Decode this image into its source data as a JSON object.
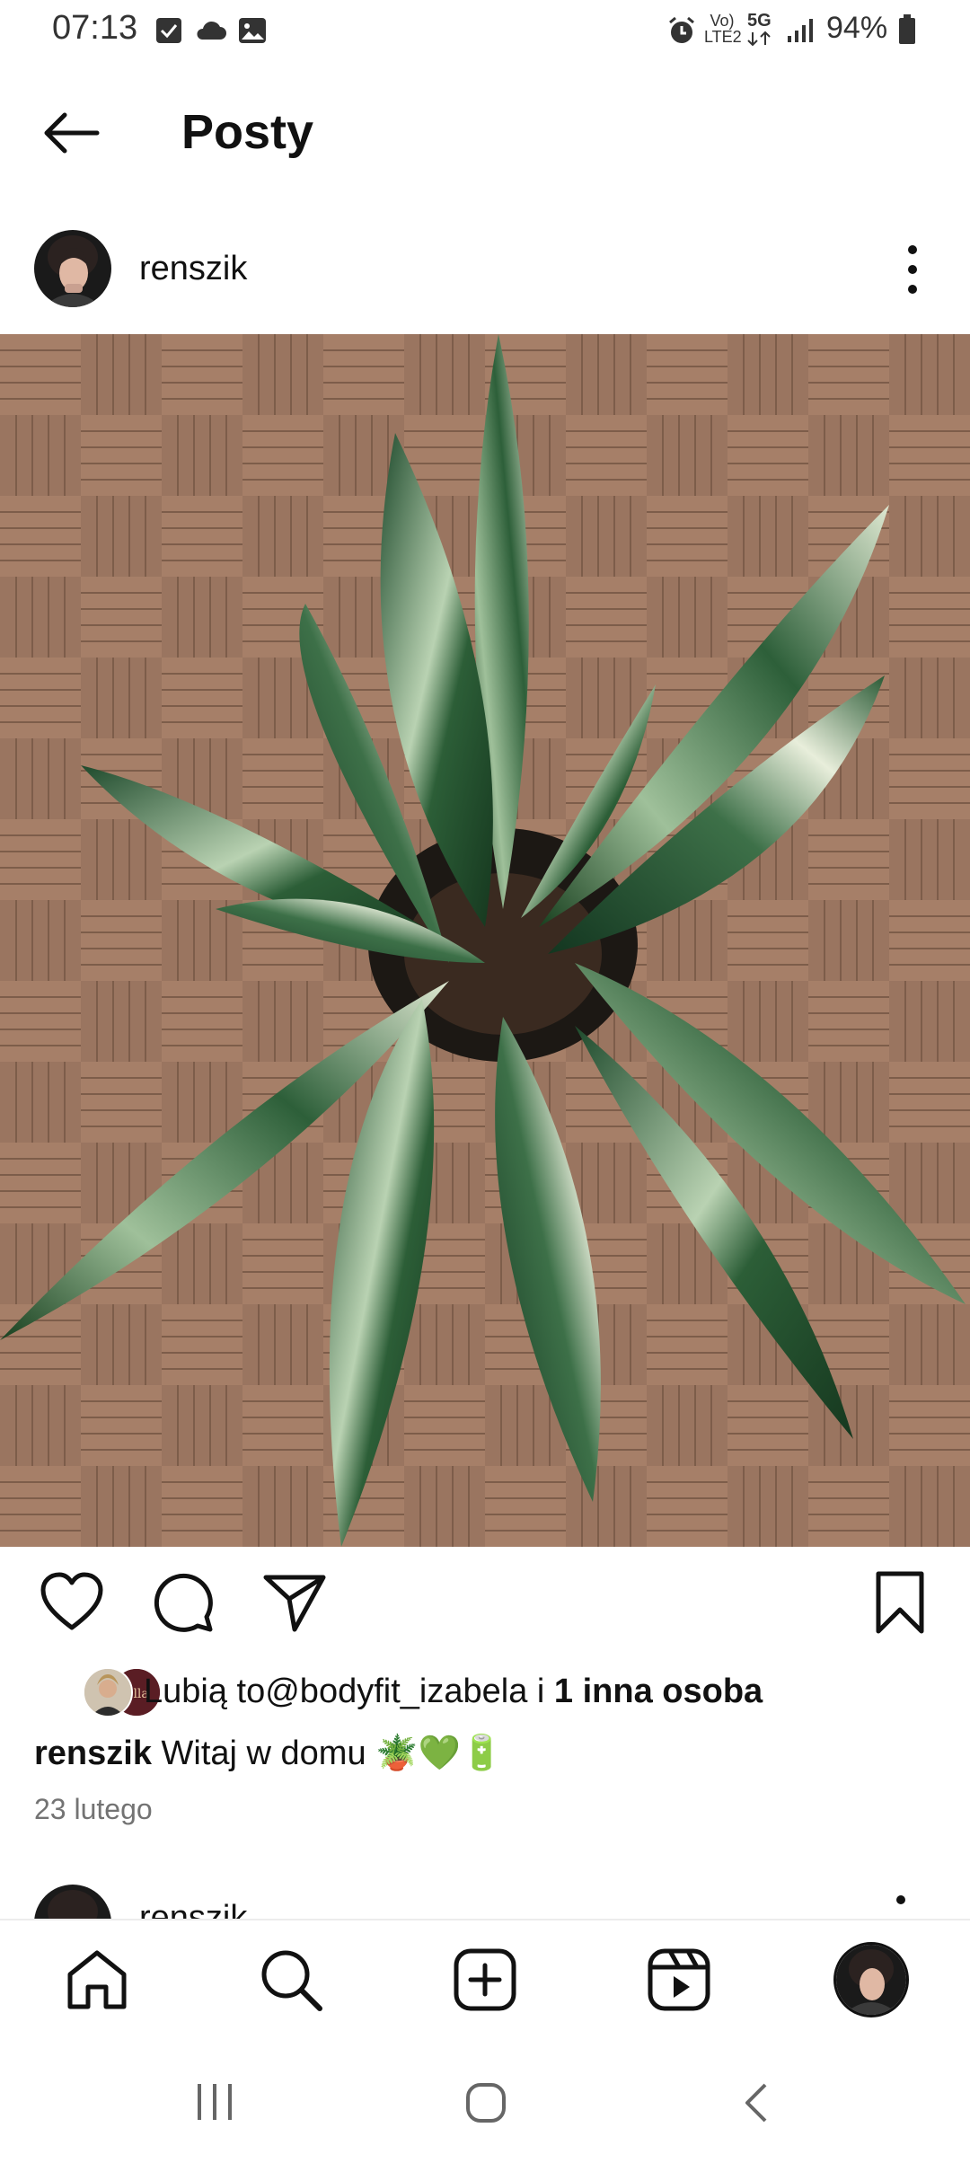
{
  "status_bar": {
    "time": "07:13",
    "network_text": "Vo) LTE2",
    "network_5g": "5G",
    "battery": "94%"
  },
  "header": {
    "title": "Posty",
    "back_icon": "arrow-left-icon"
  },
  "post": {
    "username": "renszik",
    "more_icon": "more-vertical-icon",
    "image_description_icon": "photo",
    "actions": [
      "heart-icon",
      "comment-icon",
      "share-icon",
      "bookmark-icon"
    ],
    "likes": {
      "prefix": "Lubią to",
      "user": "@bodyfit_izabela",
      "middle": " i ",
      "others": "1 inna osoba"
    },
    "caption": {
      "user": "renszik",
      "text": "Witaj w domu 🪴💚🔋"
    },
    "date": "23 lutego"
  },
  "next_post": {
    "username": "renszik"
  },
  "bottom_nav": {
    "items": [
      "home-icon",
      "search-icon",
      "create-icon",
      "reels-icon",
      "profile-avatar"
    ]
  },
  "colors": {
    "text": "#111111",
    "muted": "#737373",
    "background": "#ffffff"
  }
}
